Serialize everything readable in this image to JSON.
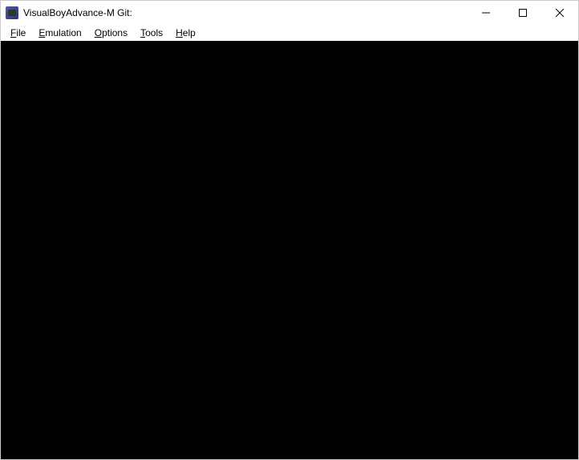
{
  "titlebar": {
    "title": "VisualBoyAdvance-M Git:"
  },
  "menubar": {
    "items": [
      {
        "label": "File",
        "accel_index": 0
      },
      {
        "label": "Emulation",
        "accel_index": 0
      },
      {
        "label": "Options",
        "accel_index": 0
      },
      {
        "label": "Tools",
        "accel_index": 0
      },
      {
        "label": "Help",
        "accel_index": 0
      }
    ]
  }
}
